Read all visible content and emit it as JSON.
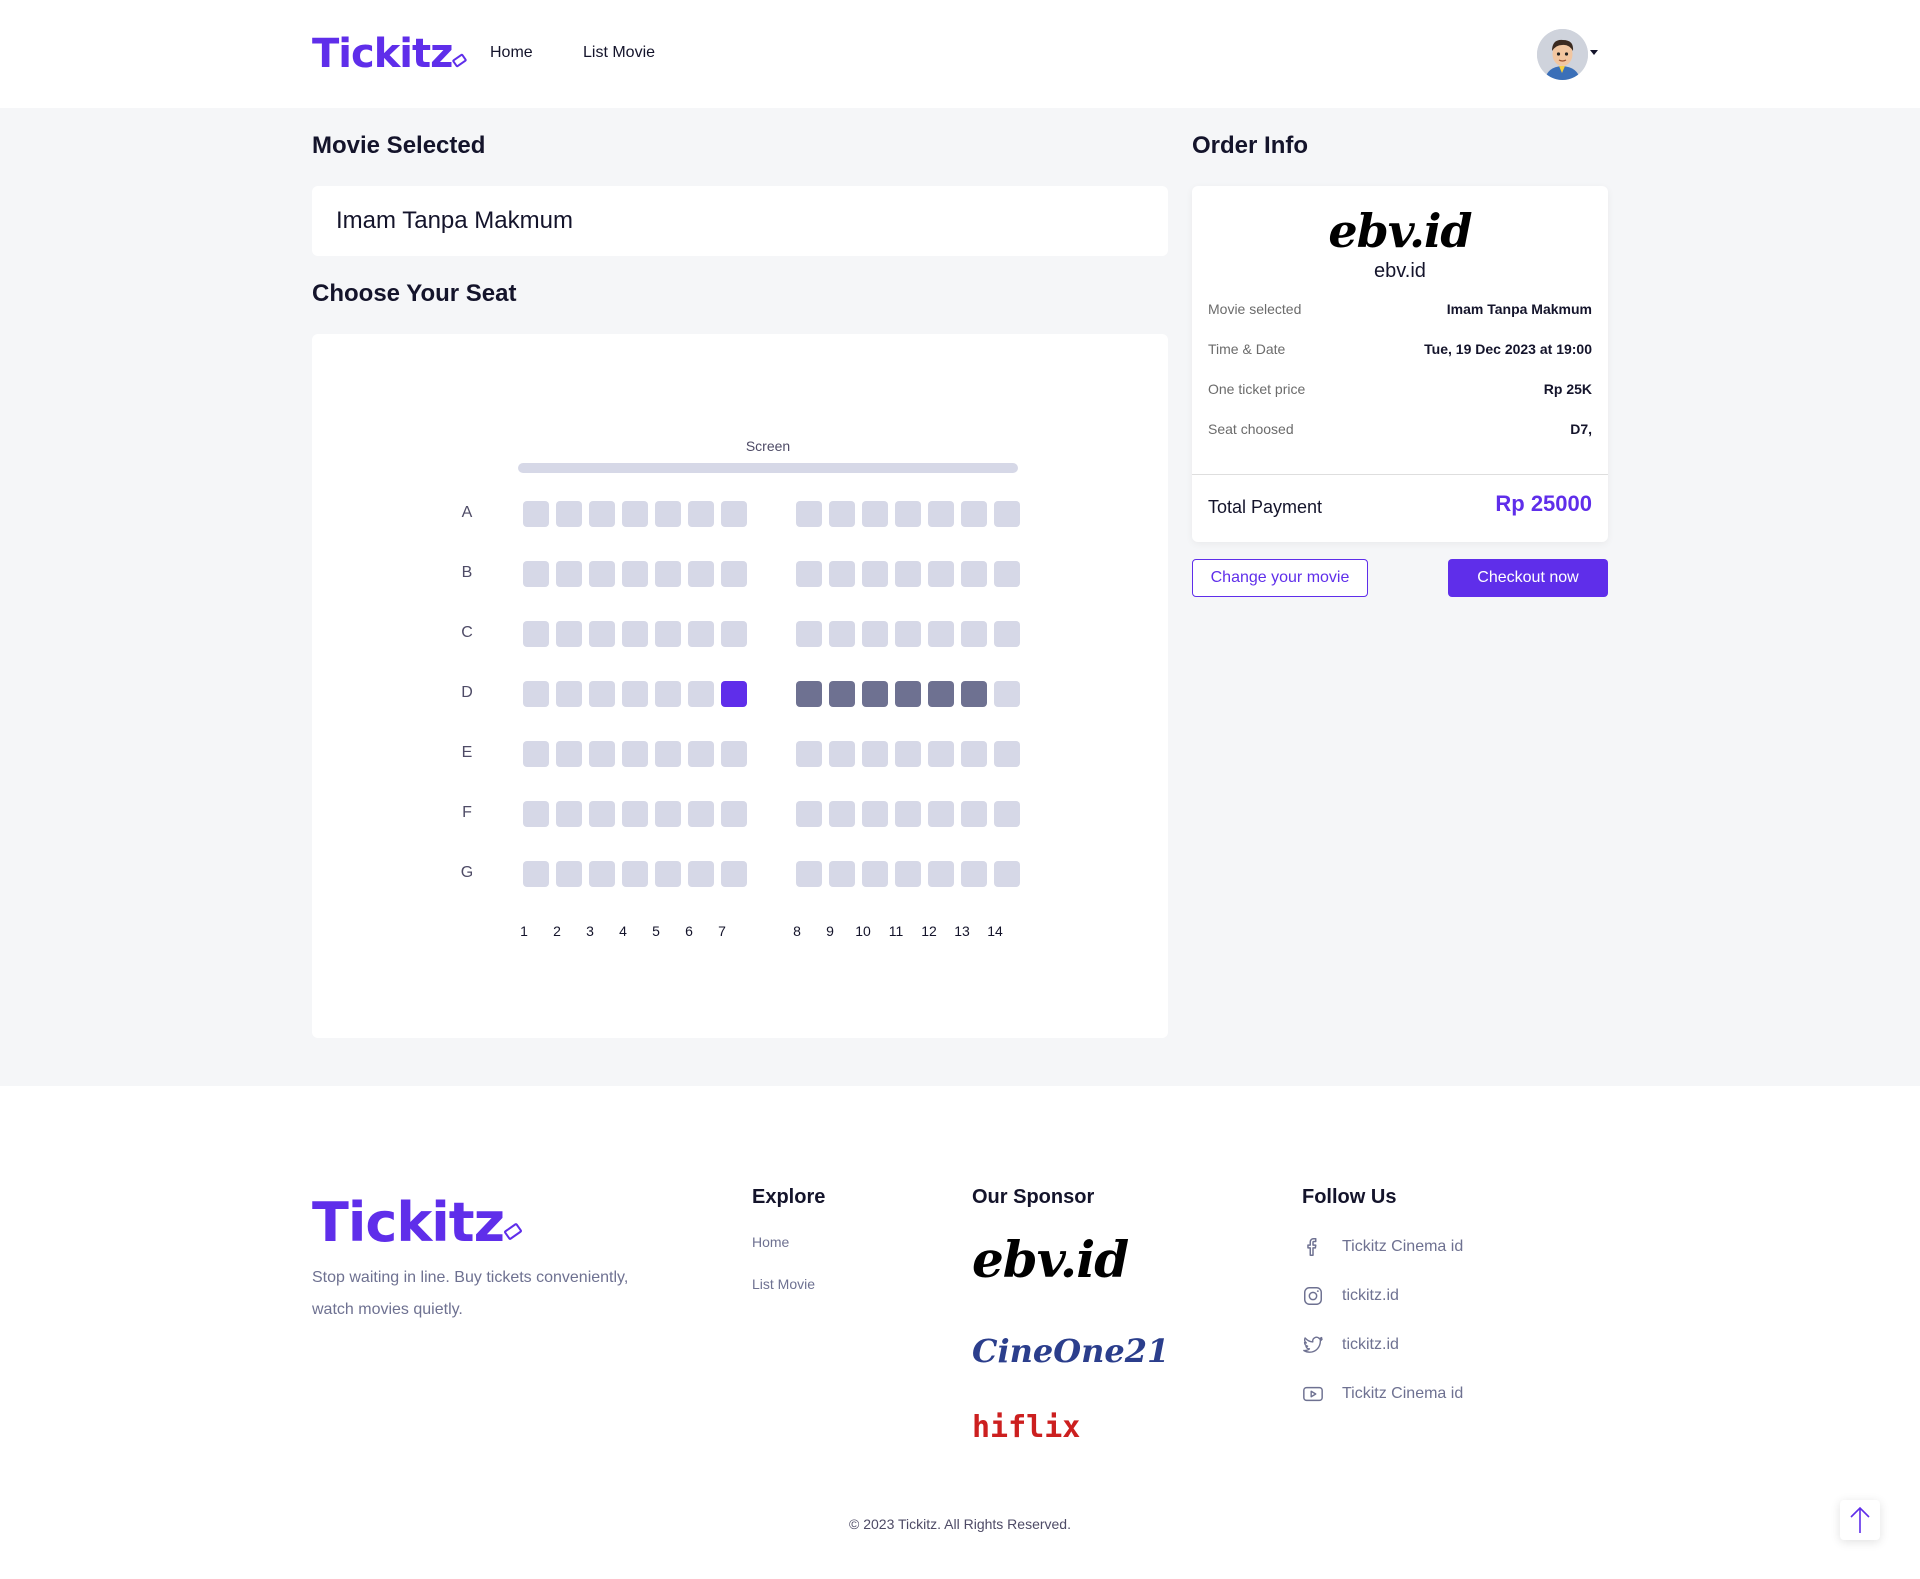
{
  "header": {
    "logo": "Tickitz",
    "nav": [
      {
        "label": "Home"
      },
      {
        "label": "List Movie"
      }
    ]
  },
  "movie_selected": {
    "title": "Movie Selected",
    "movie": "Imam Tanpa Makmum"
  },
  "seat_picker": {
    "title": "Choose Your Seat",
    "screen_label": "Screen",
    "rows": [
      "A",
      "B",
      "C",
      "D",
      "E",
      "F",
      "G"
    ],
    "columns": [
      "1",
      "2",
      "3",
      "4",
      "5",
      "6",
      "7",
      "8",
      "9",
      "10",
      "11",
      "12",
      "13",
      "14"
    ],
    "selected": [
      "D7"
    ],
    "sold": [
      "D8",
      "D9",
      "D10",
      "D11",
      "D12",
      "D13"
    ],
    "colors": {
      "available": "#d6d8e7",
      "selected": "#5f2eea",
      "sold": "#6e7191"
    }
  },
  "order_info": {
    "title": "Order Info",
    "cinema_logo": "ebv.id",
    "cinema_name": "ebv.id",
    "rows": [
      {
        "label": "Movie selected",
        "value": "Imam Tanpa Makmum"
      },
      {
        "label": "Time & Date",
        "value": "Tue, 19 Dec 2023 at 19:00"
      },
      {
        "label": "One ticket price",
        "value": "Rp 25K"
      },
      {
        "label": "Seat choosed",
        "value": "D7,"
      }
    ],
    "total_label": "Total Payment",
    "total_value": "Rp 25000",
    "change_button": "Change your movie",
    "checkout_button": "Checkout now"
  },
  "footer": {
    "logo": "Tickitz",
    "tagline": "Stop waiting in line. Buy tickets conveniently, watch movies quietly.",
    "explore": {
      "title": "Explore",
      "links": [
        "Home",
        "List Movie"
      ]
    },
    "sponsor": {
      "title": "Our Sponsor",
      "sponsors": [
        "ebv.id",
        "CineOne21",
        "hiflix"
      ]
    },
    "follow": {
      "title": "Follow Us",
      "items": [
        {
          "icon": "facebook-icon",
          "label": "Tickitz Cinema id"
        },
        {
          "icon": "instagram-icon",
          "label": "tickitz.id"
        },
        {
          "icon": "twitter-icon",
          "label": "tickitz.id"
        },
        {
          "icon": "youtube-icon",
          "label": "Tickitz Cinema id"
        }
      ]
    },
    "copyright": "© 2023 Tickitz. All Rights Reserved."
  },
  "accent_color": "#5f2eea"
}
